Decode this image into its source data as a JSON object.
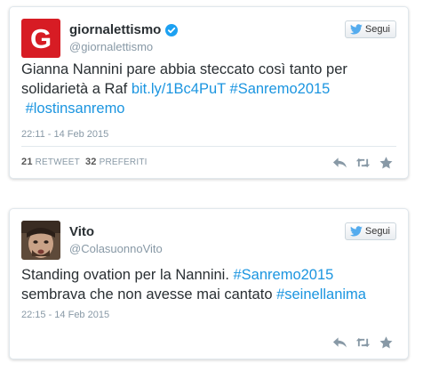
{
  "colors": {
    "link": "#1b95e0",
    "brand_red": "#d71c24",
    "verified": "#1da1f2",
    "twitter_bird": "#55acee"
  },
  "tweets": [
    {
      "avatar_letter": "G",
      "name": "giornalettismo",
      "verified": true,
      "handle": "@giornalettismo",
      "follow_label": "Segui",
      "text_plain": "Gianna Nannini pare abbia steccato così tanto per solidarietà a Raf ",
      "link1": "bit.ly/1Bc4PuT",
      "hashtag1": "#Sanremo2015",
      "hashtag2": "#lostinsanremo",
      "timestamp": "22:11 - 14 Feb 2015",
      "retweets": "21",
      "retweets_label": "RETWEET",
      "favorites": "32",
      "favorites_label": "PREFERITI",
      "icons": [
        "reply-icon",
        "retweet-icon",
        "favorite-icon"
      ]
    },
    {
      "name": "Vito",
      "handle": "@ColasuonnoVito",
      "follow_label": "Segui",
      "text_plain": "Standing ovation per la Nannini. ",
      "hashtag1": "#Sanremo2015",
      "text_plain2": "sembrava che non avesse mai cantato ",
      "hashtag2": "#seinellanima",
      "timestamp": "22:15 - 14 Feb 2015",
      "icons": [
        "reply-icon",
        "retweet-icon",
        "favorite-icon"
      ]
    }
  ]
}
